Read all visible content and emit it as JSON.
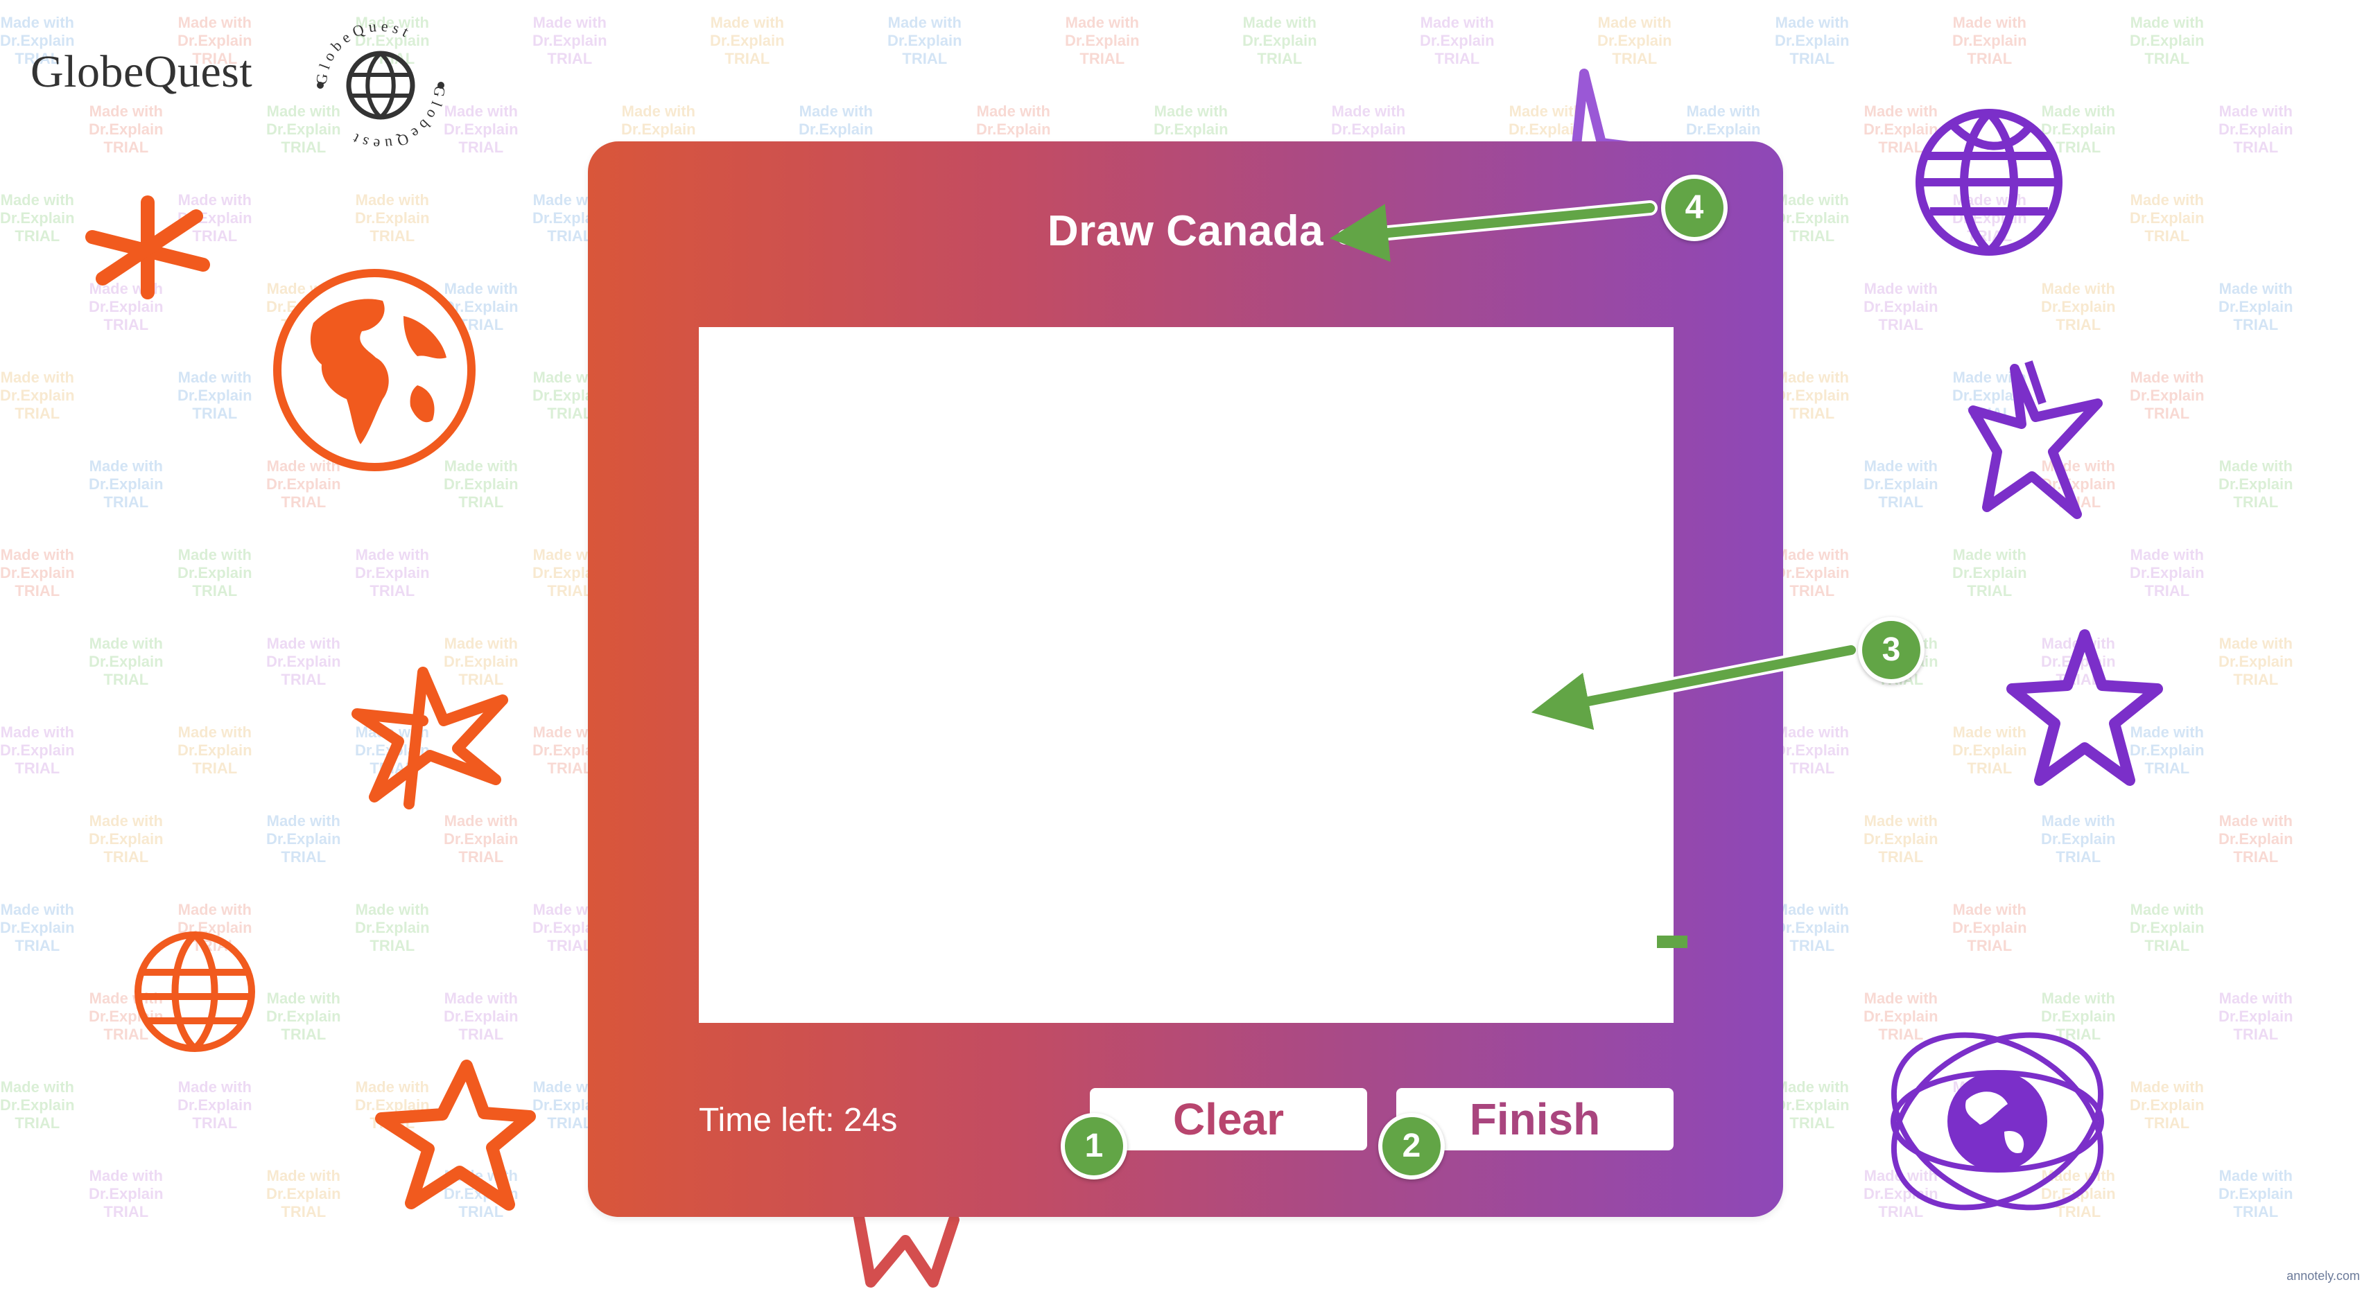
{
  "app": {
    "logo_text": "GlobeQuest",
    "badge_text": "GlobeQuest"
  },
  "watermark": {
    "line1": "Made with",
    "line2": "Dr.Explain",
    "line3": "TRIAL"
  },
  "game": {
    "prompt": "Draw Canada",
    "timer": "Time left: 24s",
    "clear_label": "Clear",
    "finish_label": "Finish"
  },
  "annotations": {
    "step1": "1",
    "step2": "2",
    "step3": "3",
    "step4": "4",
    "credit": "annotely.com"
  },
  "colors": {
    "card_start": "#d9563a",
    "card_end": "#8e48b8",
    "orange_accent": "#f15a1e",
    "purple_accent": "#7b2fc9",
    "annotation_green": "#62a546",
    "button_text": "#b8456e"
  },
  "icons": {
    "left": [
      "asterisk-icon",
      "earth-globe-icon",
      "star-doodle-icon",
      "wire-globe-icon",
      "star-outline-icon"
    ],
    "right": [
      "wire-globe-icon",
      "star-doodle-icon",
      "star-outline-icon",
      "orbit-globe-icon"
    ]
  }
}
